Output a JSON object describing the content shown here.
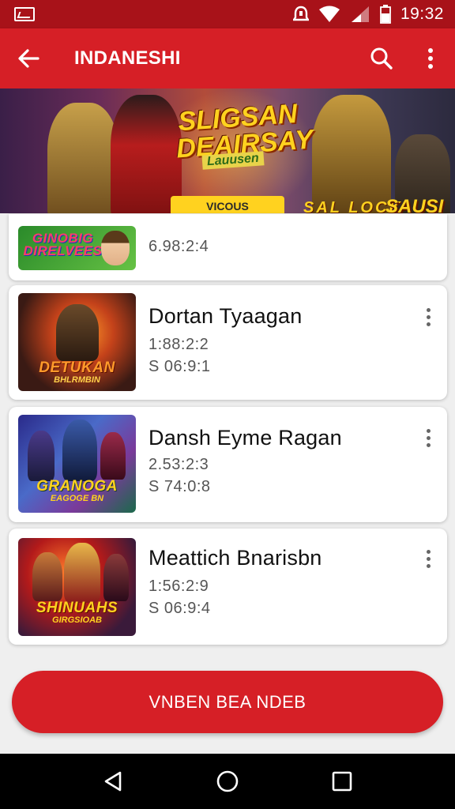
{
  "status_bar": {
    "time": "19:32",
    "icons": [
      "gallery-icon",
      "alarm-icon",
      "wifi-icon",
      "signal-icon",
      "battery-icon"
    ]
  },
  "app_bar": {
    "title": "INDANESHI",
    "back_icon": "back-arrow-icon",
    "search_icon": "search-icon",
    "more_icon": "more-vert-icon"
  },
  "banner": {
    "title": "SLIGSAN DEAIRSAY",
    "subtitle": "Lauusen",
    "pill": "VICOUS",
    "tag_left": "SAL  LOCK",
    "tag_right": "SAUSI"
  },
  "list": {
    "items": [
      {
        "thumb_text": "GINOBIG DIRELVEES",
        "name": "",
        "meta_1": "6.98:2:4",
        "meta_2": ""
      },
      {
        "thumb_text": "DETUKAN",
        "thumb_sub": "BHLRMBIN",
        "name": "Dortan Tyaagan",
        "meta_1": "1:88:2:2",
        "meta_2": "S 06:9:1"
      },
      {
        "thumb_text": "GRANOGA",
        "thumb_sub": "EAGOGE BN",
        "name": "Dansh Eyme Ragan",
        "meta_1": "2.53:2:3",
        "meta_2": "S 74:0:8"
      },
      {
        "thumb_text": "SHINUAHS",
        "thumb_sub": "GIRGSIOAB",
        "name": "Meattich Bnarisbn",
        "meta_1": "1:56:2:9",
        "meta_2": "S 06:9:4"
      }
    ]
  },
  "primary_button": {
    "label": "VNBEN BEA NDEB"
  },
  "nav_bar": {
    "icons": [
      "nav-back-icon",
      "nav-home-icon",
      "nav-recents-icon"
    ]
  },
  "colors": {
    "status_bar": "#a81219",
    "app_bar": "#d61f26",
    "primary": "#d61f26",
    "background": "#efefef"
  }
}
